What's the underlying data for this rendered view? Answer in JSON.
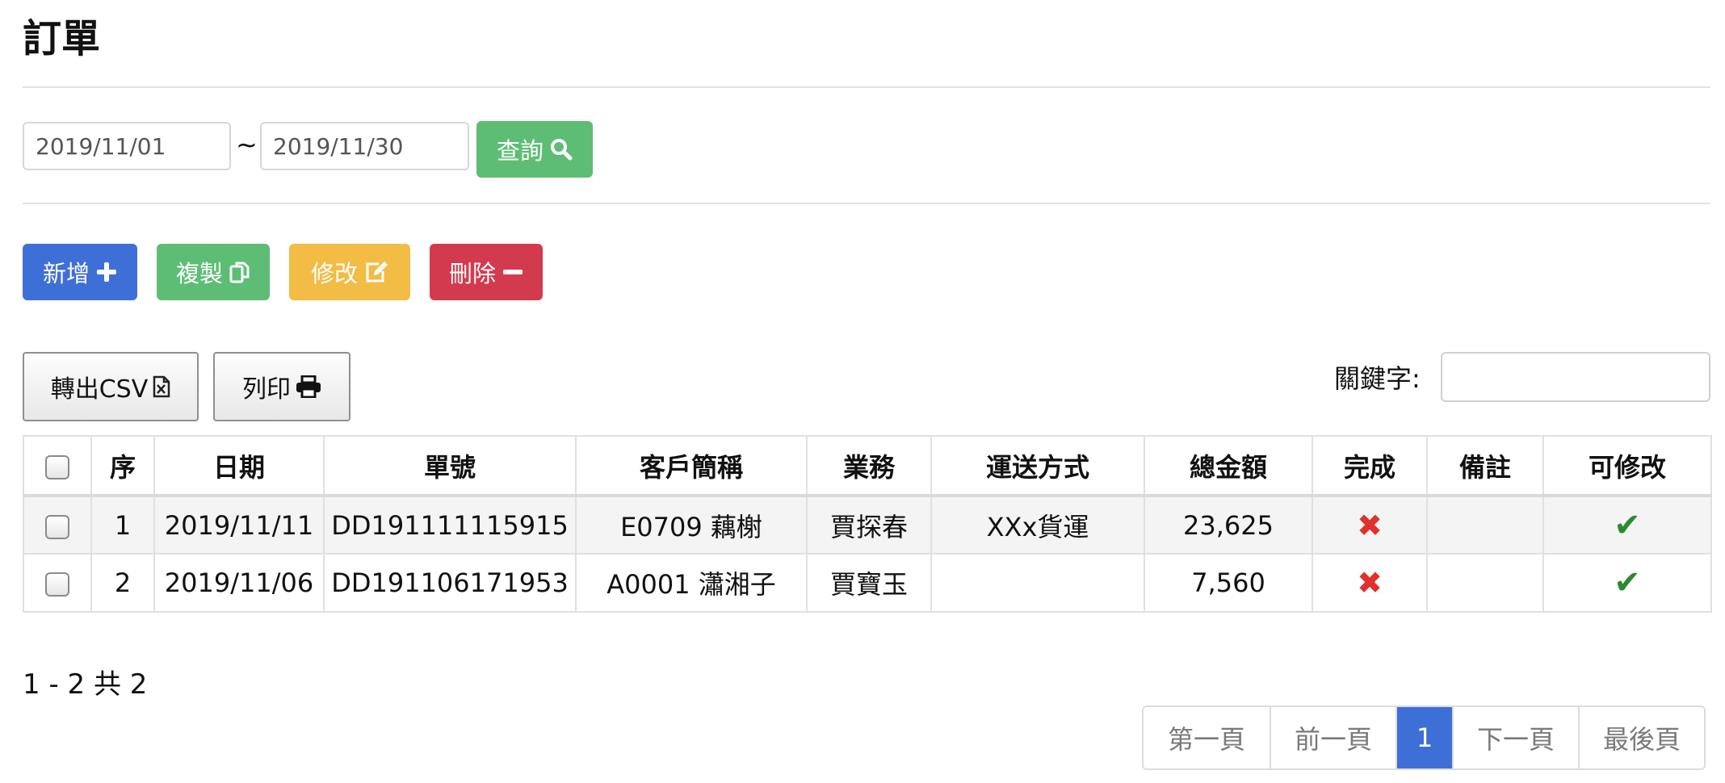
{
  "page": {
    "title": "訂單"
  },
  "filter": {
    "start_date": "2019/11/01",
    "end_date": "2019/11/30",
    "separator": "~",
    "search_label": "查詢"
  },
  "actions": {
    "add_label": "新增",
    "copy_label": "複製",
    "edit_label": "修改",
    "delete_label": "刪除"
  },
  "tools": {
    "csv_label": "轉出CSV",
    "print_label": "列印",
    "keyword_label": "關鍵字:",
    "keyword_value": ""
  },
  "table": {
    "columns": [
      "序",
      "日期",
      "單號",
      "客戶簡稱",
      "業務",
      "運送方式",
      "總金額",
      "完成",
      "備註",
      "可修改"
    ],
    "rows": [
      {
        "seq": "1",
        "date": "2019/11/11",
        "order_no": "DD191111115915",
        "customer": "E0709 藕榭",
        "sales": "賈探春",
        "shipping": "XXx貨運",
        "total": "23,625",
        "done": false,
        "note": "",
        "editable": true
      },
      {
        "seq": "2",
        "date": "2019/11/06",
        "order_no": "DD191106171953",
        "customer": "A0001 瀟湘子",
        "sales": "賈寶玉",
        "shipping": "",
        "total": "7,560",
        "done": false,
        "note": "",
        "editable": true
      }
    ]
  },
  "summary": {
    "text": "1 - 2 共 2"
  },
  "pagination": {
    "first_label": "第一頁",
    "prev_label": "前一頁",
    "current_page": "1",
    "next_label": "下一頁",
    "last_label": "最後頁"
  },
  "colors": {
    "primary": "#3e6fd6",
    "success": "#5dbd74",
    "warning": "#f2bc45",
    "danger": "#d33a4e",
    "cross": "#e0312c",
    "check": "#2e8a2e"
  },
  "icons": {
    "date_picker": "calendar-icon",
    "search": "search-icon",
    "add": "plus-icon",
    "copy": "copy-icon",
    "edit": "edit-icon",
    "delete": "minus-icon",
    "csv": "file-excel-icon",
    "print": "print-icon",
    "not_done": "cross-icon",
    "editable": "check-icon"
  }
}
